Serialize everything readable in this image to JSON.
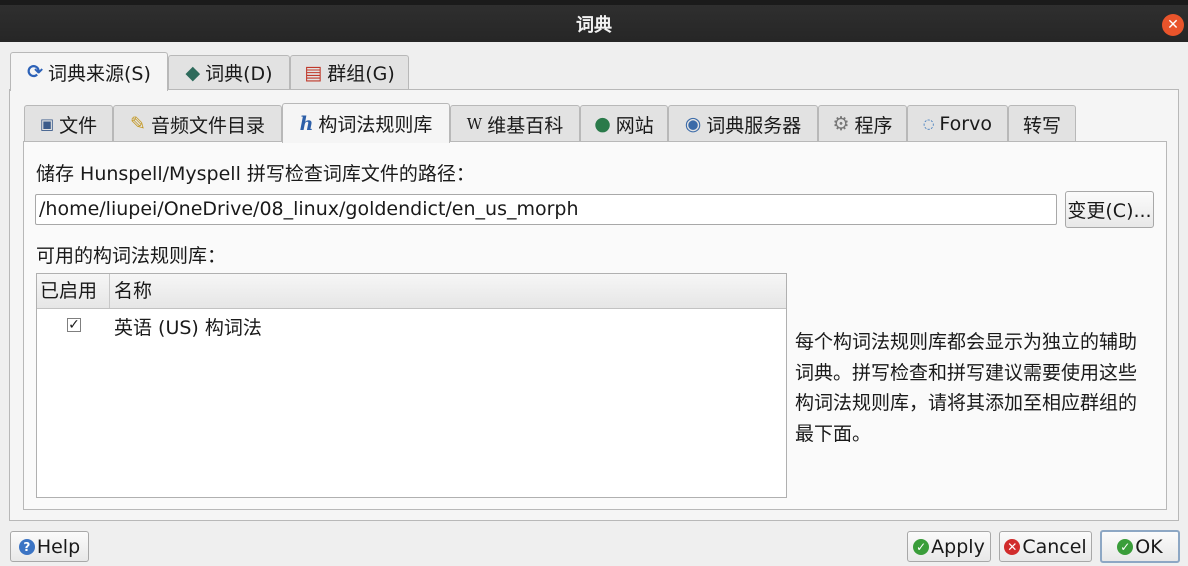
{
  "window": {
    "title": "词典"
  },
  "top_tabs": [
    {
      "label": "词典来源(S)",
      "icon": "refresh-icon"
    },
    {
      "label": "词典(D)",
      "icon": "book-icon"
    },
    {
      "label": "群组(G)",
      "icon": "books-icon"
    }
  ],
  "sub_tabs": [
    {
      "label": "文件",
      "icon": "file-icon"
    },
    {
      "label": "音频文件目录",
      "icon": "folder-audio-icon"
    },
    {
      "label": "构词法规则库",
      "icon": "h-icon"
    },
    {
      "label": "维基百科",
      "icon": "wikipedia-icon"
    },
    {
      "label": "网站",
      "icon": "globe-icon"
    },
    {
      "label": "词典服务器",
      "icon": "server-icon"
    },
    {
      "label": "程序",
      "icon": "gear-icon"
    },
    {
      "label": "Forvo",
      "icon": "forvo-icon"
    },
    {
      "label": "转写",
      "icon": ""
    }
  ],
  "morphology": {
    "path_label": "储存 Hunspell/Myspell 拼写检查词库文件的路径：",
    "path_value": "/home/liupei/OneDrive/08_linux/goldendict/en_us_morph",
    "change_button": "变更(C)...",
    "available_label": "可用的构词法规则库：",
    "table": {
      "columns": [
        "已启用",
        "名称"
      ],
      "rows": [
        {
          "enabled": true,
          "name": "英语 (US) 构词法"
        }
      ]
    },
    "info_lines": [
      "每个构词法规则库都会显示为独立的辅助",
      "词典。拼写检查和拼写建议需要使用这些",
      "构词法规则库，请将其添加至相应群组的",
      "最下面。"
    ]
  },
  "buttons": {
    "help": "Help",
    "apply": "Apply",
    "cancel": "Cancel",
    "ok": "OK"
  },
  "colors": {
    "close": "#e9542b",
    "apply": "#3a9d3a",
    "cancel": "#d12c2c",
    "help": "#3b74c4"
  }
}
